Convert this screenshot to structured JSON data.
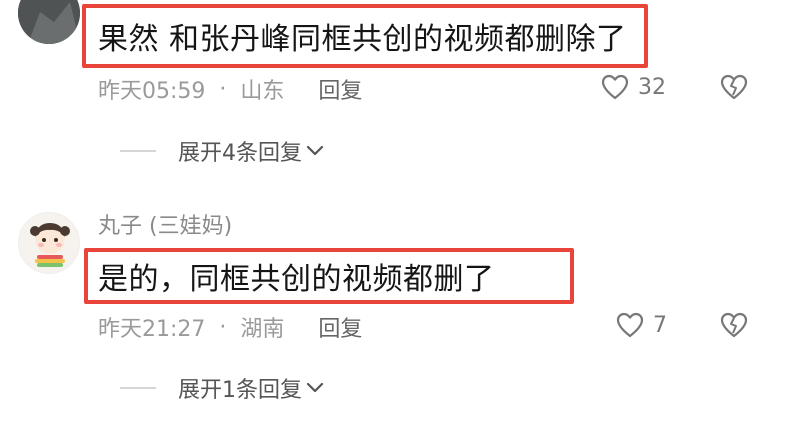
{
  "comments": [
    {
      "text": "果然 和张丹峰同框共创的视频都删除了",
      "time": "昨天05:59",
      "separator": "·",
      "location": "山东",
      "reply_label": "回复",
      "likes": "32",
      "expand_label": "展开4条回复"
    },
    {
      "username": "丸子 (三娃妈)",
      "text": "是的，同框共创的视频都删了",
      "time": "昨天21:27",
      "separator": "·",
      "location": "湖南",
      "reply_label": "回复",
      "likes": "7",
      "expand_label": "展开1条回复"
    }
  ],
  "icons": {
    "like": "heart-outline-icon",
    "dislike": "broken-heart-icon",
    "expand": "chevron-down-icon"
  },
  "colors": {
    "highlight": "#e8443a",
    "meta_text": "#9a9a9a"
  }
}
